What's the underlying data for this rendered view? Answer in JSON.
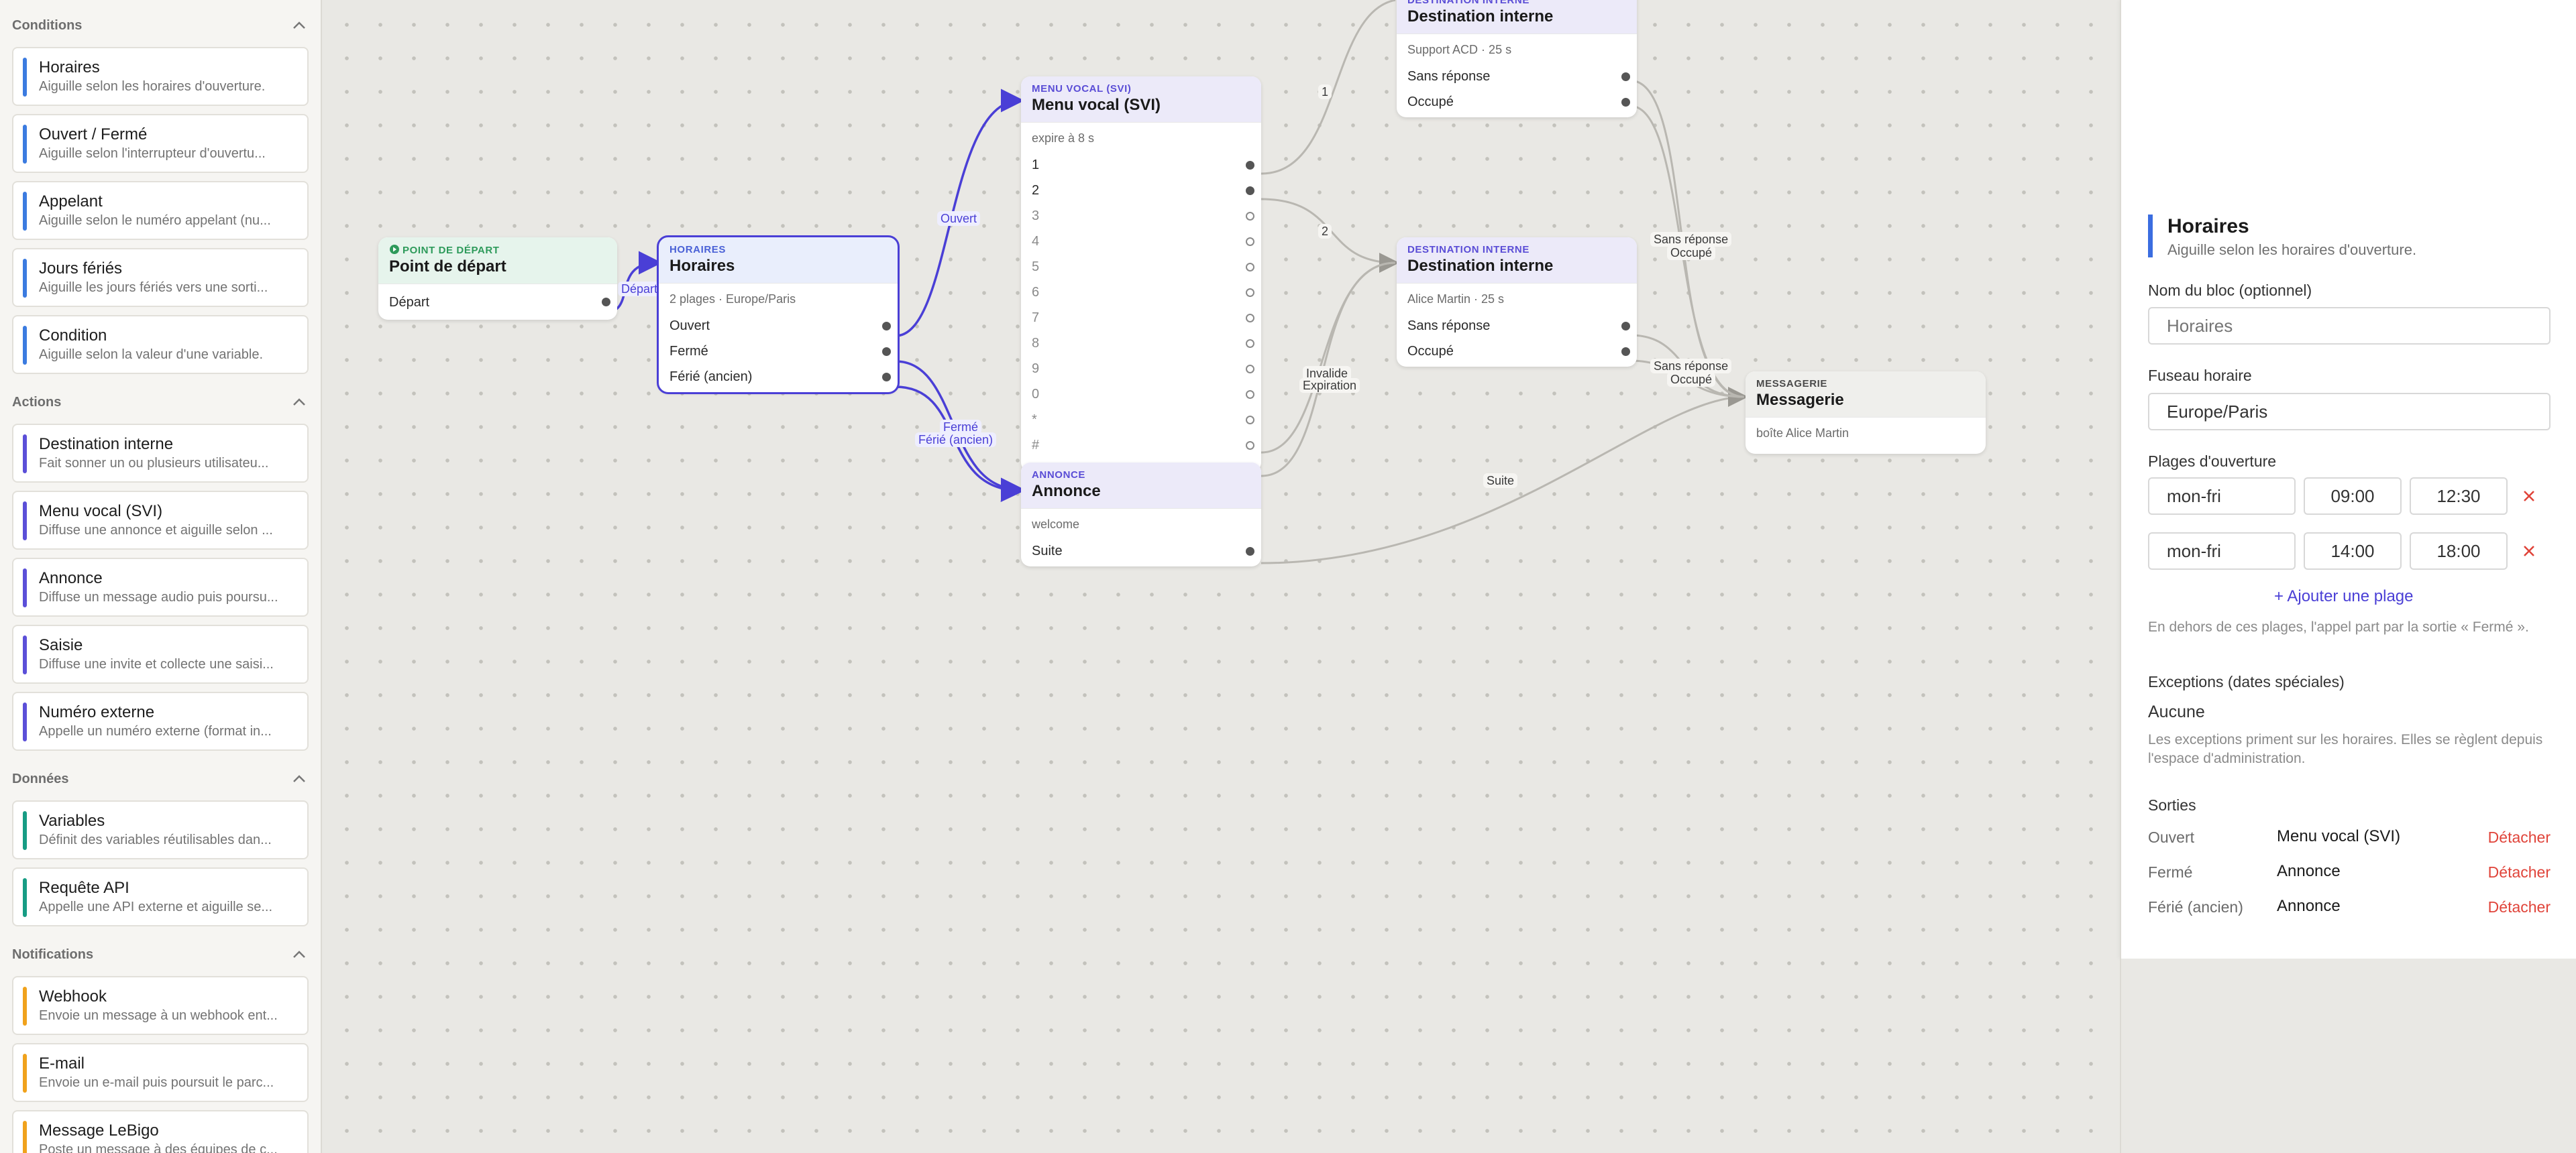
{
  "sidebar": {
    "sections": [
      {
        "title": "Conditions",
        "items": [
          {
            "title": "Horaires",
            "desc": "Aiguille selon les horaires d'ouverture.",
            "color": "#3b7be0"
          },
          {
            "title": "Ouvert / Fermé",
            "desc": "Aiguille selon l'interrupteur d'ouvertu...",
            "color": "#3b7be0"
          },
          {
            "title": "Appelant",
            "desc": "Aiguille selon le numéro appelant (nu...",
            "color": "#3b7be0"
          },
          {
            "title": "Jours fériés",
            "desc": "Aiguille les jours fériés vers une sorti...",
            "color": "#3b7be0"
          },
          {
            "title": "Condition",
            "desc": "Aiguille selon la valeur d'une variable.",
            "color": "#3b7be0"
          }
        ]
      },
      {
        "title": "Actions",
        "items": [
          {
            "title": "Destination interne",
            "desc": "Fait sonner un ou plusieurs utilisateu...",
            "color": "#5b4fd8"
          },
          {
            "title": "Menu vocal (SVI)",
            "desc": "Diffuse une annonce et aiguille selon ...",
            "color": "#5b4fd8"
          },
          {
            "title": "Annonce",
            "desc": "Diffuse un message audio puis poursu...",
            "color": "#5b4fd8"
          },
          {
            "title": "Saisie",
            "desc": "Diffuse une invite et collecte une saisi...",
            "color": "#5b4fd8"
          },
          {
            "title": "Numéro externe",
            "desc": "Appelle un numéro externe (format in...",
            "color": "#5b4fd8"
          }
        ]
      },
      {
        "title": "Données",
        "items": [
          {
            "title": "Variables",
            "desc": "Définit des variables réutilisables dan...",
            "color": "#179c84"
          },
          {
            "title": "Requête API",
            "desc": "Appelle une API externe et aiguille se...",
            "color": "#179c84"
          }
        ]
      },
      {
        "title": "Notifications",
        "items": [
          {
            "title": "Webhook",
            "desc": "Envoie un message à un webhook ent...",
            "color": "#f0a21c"
          },
          {
            "title": "E-mail",
            "desc": "Envoie un e-mail puis poursuit le parc...",
            "color": "#f0a21c"
          },
          {
            "title": "Message LeBigo",
            "desc": "Poste un message à des équipes de c...",
            "color": "#f0a21c"
          }
        ]
      }
    ]
  },
  "nodes": {
    "start": {
      "type": "Point de départ",
      "title": "Point de départ",
      "ports": [
        "Départ"
      ]
    },
    "horaires": {
      "type": "Horaires",
      "title": "Horaires",
      "meta": "2 plages · Europe/Paris",
      "ports": [
        "Ouvert",
        "Fermé",
        "Férié (ancien)"
      ]
    },
    "svi": {
      "type": "Menu vocal (SVI)",
      "title": "Menu vocal (SVI)",
      "meta": "expire à 8 s",
      "ports": [
        "1",
        "2",
        "3",
        "4",
        "5",
        "6",
        "7",
        "8",
        "9",
        "0",
        "*",
        "#"
      ]
    },
    "annonce": {
      "type": "Annonce",
      "title": "Annonce",
      "meta": "welcome",
      "ports": [
        "Suite"
      ]
    },
    "dest_top": {
      "type": "Destination interne",
      "title": "Destination interne",
      "meta": "Support ACD · 25 s",
      "ports": [
        "Sans réponse",
        "Occupé"
      ]
    },
    "dest_mid": {
      "type": "Destination interne",
      "title": "Destination interne",
      "meta": "Alice Martin · 25 s",
      "ports": [
        "Sans réponse",
        "Occupé"
      ]
    },
    "messagerie": {
      "type": "Messagerie",
      "title": "Messagerie",
      "meta": "boîte Alice Martin"
    }
  },
  "edge_labels": {
    "depart": "Départ",
    "ouvert": "Ouvert",
    "ferme": "Fermé",
    "ferie": "Férié (ancien)",
    "one": "1",
    "two": "2",
    "invalide": "Invalide",
    "expiration": "Expiration",
    "suite": "Suite",
    "sans_reponse_1": "Sans réponse",
    "occupe_1": "Occupé",
    "sans_reponse_2": "Sans réponse",
    "occupe_2": "Occupé"
  },
  "panel": {
    "title": "Horaires",
    "subtitle": "Aiguille selon les horaires d'ouverture.",
    "name_label": "Nom du bloc (optionnel)",
    "name_placeholder": "Horaires",
    "tz_label": "Fuseau horaire",
    "tz_value": "Europe/Paris",
    "slots_label": "Plages d'ouverture",
    "slots": [
      {
        "days": "mon-fri",
        "start": "09:00",
        "end": "12:30"
      },
      {
        "days": "mon-fri",
        "start": "14:00",
        "end": "18:00"
      }
    ],
    "add_slot": "+ Ajouter une plage",
    "slots_note": "En dehors de ces plages, l'appel part par la sortie « Fermé ».",
    "exceptions_label": "Exceptions (dates spéciales)",
    "exceptions_value": "Aucune",
    "exceptions_note": "Les exceptions priment sur les horaires. Elles se règlent depuis l'espace d'administration.",
    "outputs_label": "Sorties",
    "outputs": [
      {
        "name": "Ouvert",
        "target": "Menu vocal (SVI)",
        "action": "Détacher"
      },
      {
        "name": "Fermé",
        "target": "Annonce",
        "action": "Détacher"
      },
      {
        "name": "Férié (ancien)",
        "target": "Annonce",
        "action": "Détacher"
      }
    ]
  },
  "colors": {
    "accent": "#4a3fd6",
    "danger": "#e0443a",
    "edge": "#b9b7b1"
  }
}
